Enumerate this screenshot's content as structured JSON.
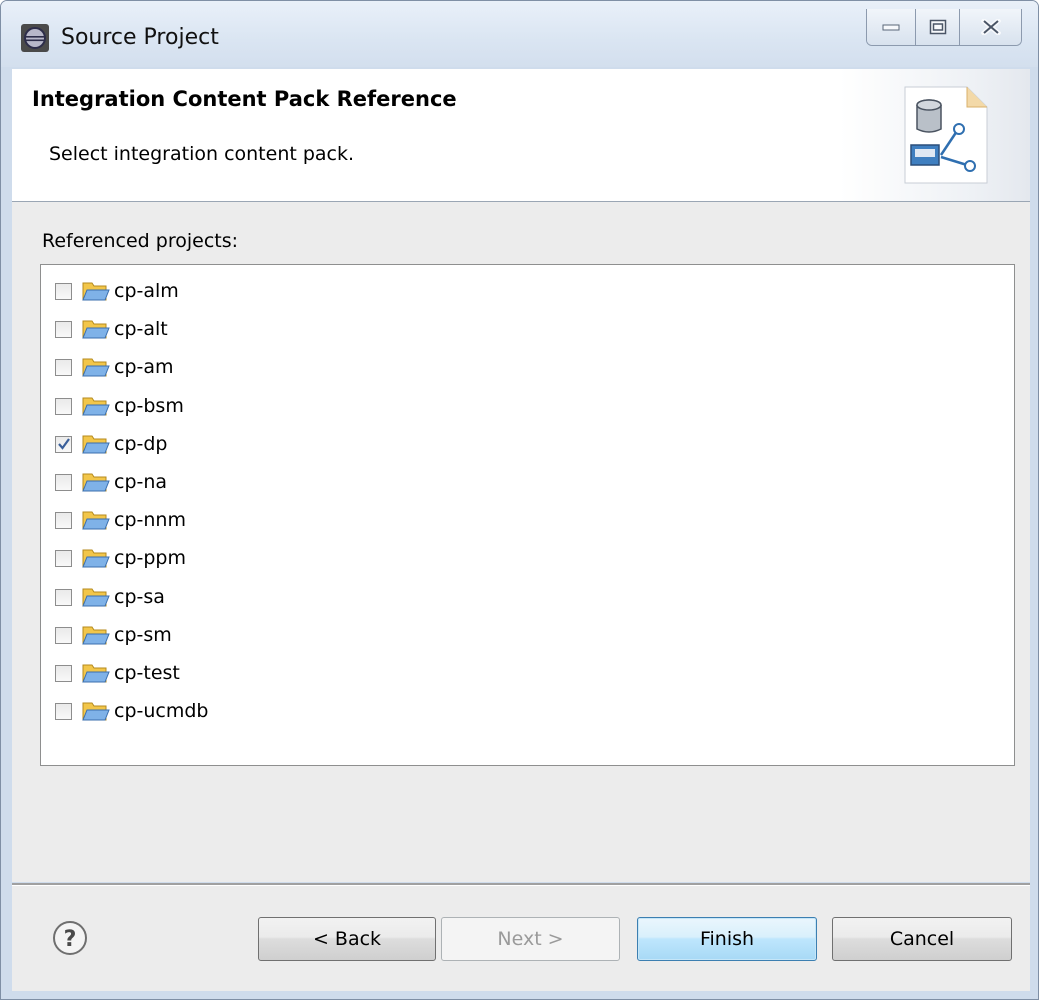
{
  "window": {
    "title": "Source Project",
    "icon": "eclipse-icon"
  },
  "header": {
    "title": "Integration Content Pack Reference",
    "description": "Select integration content pack.",
    "image": "wizard-database-connection-icon"
  },
  "content": {
    "referenced_label": "Referenced projects:",
    "projects": [
      {
        "label": "cp-alm",
        "checked": false
      },
      {
        "label": "cp-alt",
        "checked": false
      },
      {
        "label": "cp-am",
        "checked": false
      },
      {
        "label": "cp-bsm",
        "checked": false
      },
      {
        "label": "cp-dp",
        "checked": true
      },
      {
        "label": "cp-na",
        "checked": false
      },
      {
        "label": "cp-nnm",
        "checked": false
      },
      {
        "label": "cp-ppm",
        "checked": false
      },
      {
        "label": "cp-sa",
        "checked": false
      },
      {
        "label": "cp-sm",
        "checked": false
      },
      {
        "label": "cp-test",
        "checked": false
      },
      {
        "label": "cp-ucmdb",
        "checked": false
      }
    ]
  },
  "footer": {
    "back_label": "< Back",
    "next_label": "Next >",
    "finish_label": "Finish",
    "cancel_label": "Cancel",
    "next_disabled": true
  },
  "colors": {
    "default_button": "#a7d9f5",
    "folder": "#f2c64a",
    "folder_open": "#7fb2e8"
  }
}
